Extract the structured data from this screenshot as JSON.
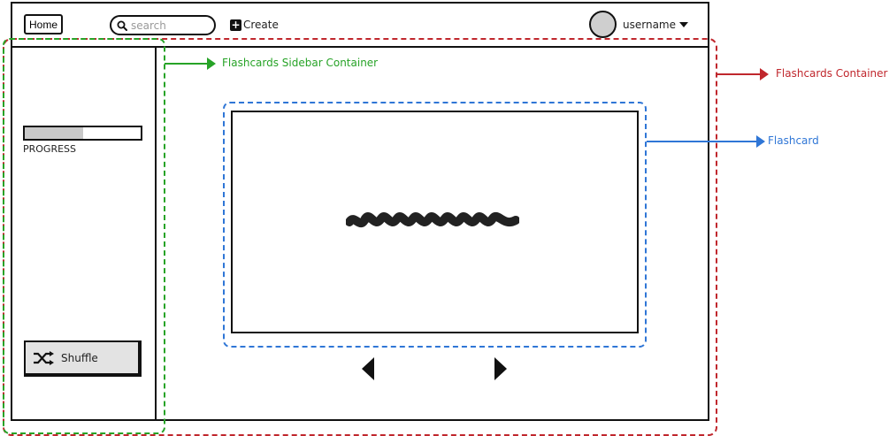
{
  "topbar": {
    "home_label": "Home",
    "search_placeholder": "search",
    "create_label": "Create",
    "username": "username"
  },
  "sidebar": {
    "progress_label": "PROGRESS",
    "progress_value": 0.5,
    "shuffle_label": "Shuffle"
  },
  "annotations": {
    "sidebar_container": "Flashcards Sidebar Container",
    "flashcards_container": "Flashcards Container",
    "flashcard": "Flashcard"
  },
  "colors": {
    "sidebar_annotation": "#27a327",
    "container_annotation": "#c0272d",
    "flashcard_annotation": "#2f76d6",
    "progress_fill": "#c9c9c9"
  },
  "icons": {
    "search": "search-icon",
    "create": "plus-square-icon",
    "user_menu": "caret-down-icon",
    "shuffle": "shuffle-icon",
    "prev": "triangle-left-icon",
    "next": "triangle-right-icon"
  }
}
